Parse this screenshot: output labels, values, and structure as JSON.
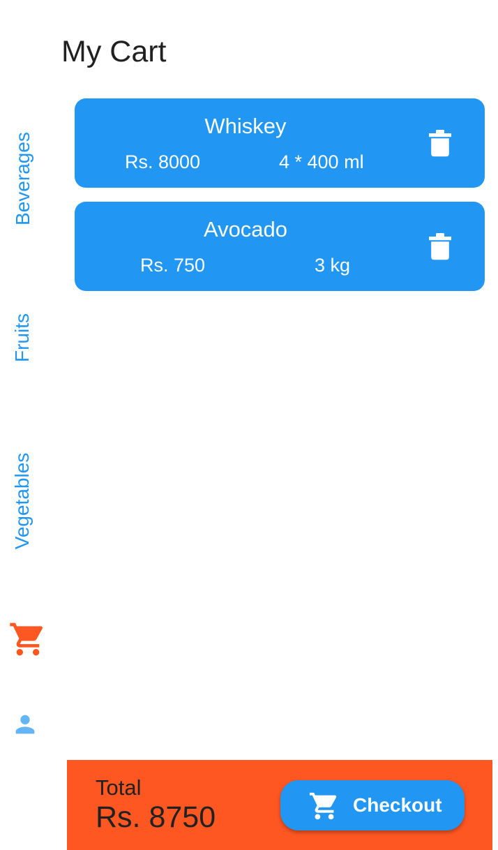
{
  "header": {
    "title": "My Cart"
  },
  "side_nav": {
    "items": [
      {
        "label": "Beverages"
      },
      {
        "label": "Fruits"
      },
      {
        "label": "Vegetables"
      }
    ],
    "cart_icon": "shopping-cart-icon",
    "profile_icon": "person-icon",
    "active_color": "#FF5722",
    "inactive_color": "#2196F3"
  },
  "cart": {
    "items": [
      {
        "name": "Whiskey",
        "price": "Rs. 8000",
        "quantity": "4 * 400 ml",
        "icon": "trash-icon"
      },
      {
        "name": "Avocado",
        "price": "Rs. 750",
        "quantity": "3 kg",
        "icon": "trash-icon"
      }
    ]
  },
  "footer": {
    "total_label": "Total",
    "total_value": "Rs. 8750",
    "checkout_label": "Checkout",
    "checkout_icon": "shopping-cart-icon"
  },
  "colors": {
    "primary": "#2196F3",
    "accent": "#FF5722",
    "text": "#212121"
  }
}
